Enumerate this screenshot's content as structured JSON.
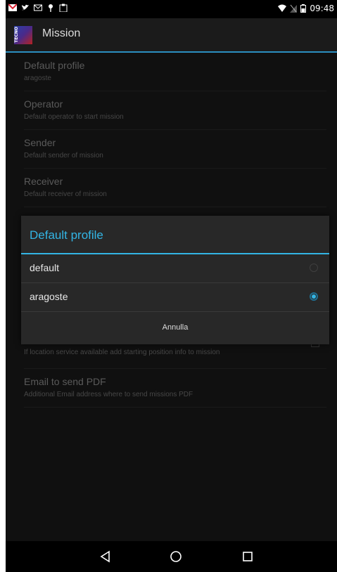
{
  "status_bar": {
    "time": "09:48",
    "icons_left": [
      "gmail-icon",
      "twitter-icon",
      "mail-icon",
      "pin-icon",
      "clipboard-icon"
    ],
    "icons_right": [
      "wifi-icon",
      "no-signal-icon",
      "battery-icon"
    ]
  },
  "action_bar": {
    "title": "Mission",
    "app_icon_text": "TECNO"
  },
  "preferences": [
    {
      "title": "Default profile",
      "summary": "aragoste"
    },
    {
      "title": "Operator",
      "summary": "Default operator to start mission"
    },
    {
      "title": "Sender",
      "summary": "Default sender of mission"
    },
    {
      "title": "Receiver",
      "summary": "Default receiver of mission"
    },
    {
      "title": "",
      "summary": "If location service available add starting position info to mission"
    },
    {
      "title": "Email to send PDF",
      "summary": "Additional Email address where to send missions PDF"
    }
  ],
  "dialog": {
    "title": "Default profile",
    "options": [
      {
        "label": "default",
        "selected": false
      },
      {
        "label": "aragoste",
        "selected": true
      }
    ],
    "cancel_label": "Annulla"
  },
  "nav_bar": {
    "icons": [
      "back-icon",
      "home-icon",
      "recents-icon"
    ]
  },
  "colors": {
    "accent": "#33b5e5",
    "background": "#101010",
    "dialog_bg": "#282828"
  }
}
